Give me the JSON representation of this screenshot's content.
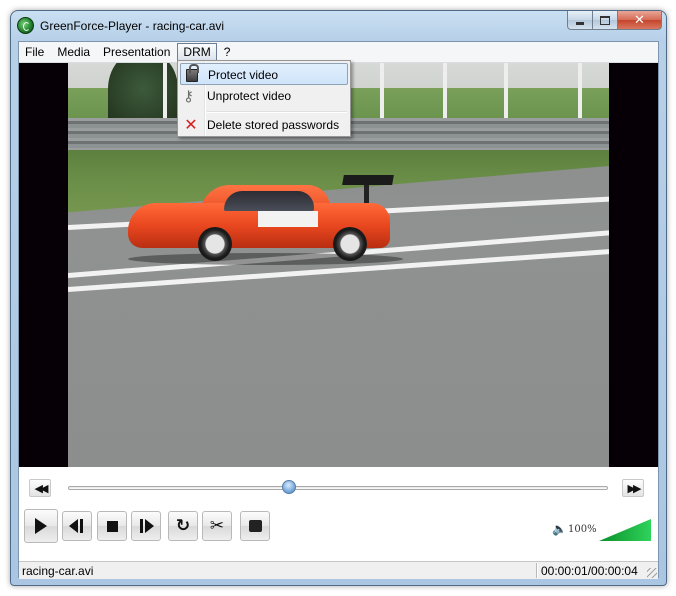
{
  "window": {
    "title": "GreenForce-Player - racing-car.avi",
    "icon": "greenforce-app-icon",
    "caption_buttons": [
      "minimize",
      "maximize",
      "close"
    ]
  },
  "menubar": {
    "items": [
      {
        "label": "File"
      },
      {
        "label": "Media"
      },
      {
        "label": "Presentation"
      },
      {
        "label": "DRM",
        "active": true
      },
      {
        "label": "?"
      }
    ]
  },
  "drm_menu": {
    "items": [
      {
        "label": "Protect video",
        "icon": "lock-icon",
        "highlighted": true
      },
      {
        "label": "Unprotect video",
        "icon": "key-icon"
      },
      {
        "label": "Delete stored passwords",
        "icon": "red-x-icon"
      }
    ]
  },
  "video": {
    "description_icon": "video-frame",
    "file": "racing-car.avi"
  },
  "controls": {
    "seek_position": 0.41,
    "buttons": [
      "rewind",
      "fast-forward",
      "play",
      "previous-frame",
      "stop",
      "next-frame",
      "repeat",
      "cut",
      "snapshot"
    ],
    "volume": {
      "label": "100%",
      "level": 1.0
    }
  },
  "statusbar": {
    "file": "racing-car.avi",
    "time": "00:00:01/00:00:04"
  },
  "colors": {
    "highlight": "#cfe4fa",
    "volume_green": "#2fd35a",
    "close_red": "#c4452c"
  }
}
